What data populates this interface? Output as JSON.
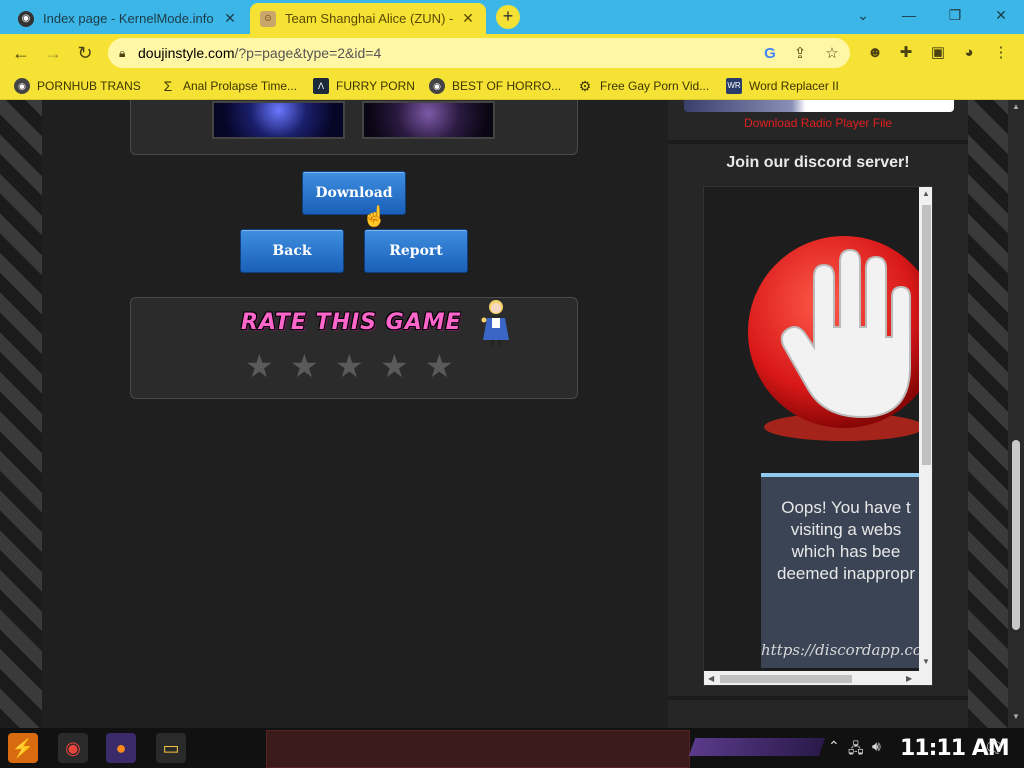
{
  "tabs": [
    {
      "title": "Index page - KernelMode.info",
      "favicon": "globe-icon",
      "active": false
    },
    {
      "title": "Team Shanghai Alice (ZUN) - ",
      "favicon": "doujinstyle-icon",
      "active": true
    }
  ],
  "toolbar": {
    "url_host": "doujinstyle.com",
    "url_path": "/?p=page&type=2&id=4"
  },
  "bookmarks": [
    {
      "label": "PORNHUB TRANS",
      "icon": "globe-icon"
    },
    {
      "label": "Anal Prolapse Time...",
      "icon": "sigma-icon"
    },
    {
      "label": "FURRY PORN",
      "icon": "arrow-logo-icon"
    },
    {
      "label": "BEST OF HORRO...",
      "icon": "globe-icon"
    },
    {
      "label": "Free Gay Porn Vid...",
      "icon": "gear-icon"
    },
    {
      "label": "Word Replacer II",
      "icon": "wr-icon"
    }
  ],
  "main": {
    "download_label": "Download",
    "back_label": "Back",
    "report_label": "Report",
    "rate_title": "RATE THIS GAME",
    "stars_total": 5,
    "rating": 0
  },
  "sidebar": {
    "radio_link": "Download Radio Player File",
    "discord_heading": "Join our discord server!",
    "blocked_lines": [
      "Oops! You have t",
      "visiting a webs",
      "which has bee",
      "deemed inappropr"
    ],
    "blocked_url": "https://discordapp.co"
  },
  "taskbar": {
    "clock": "11:11 AM"
  },
  "colors": {
    "tabbar": "#3bb6e6",
    "chrome_yellow": "#f5e234",
    "button_blue": "#1a5fb8",
    "rate_pink": "#ff66cc",
    "link_red": "#e02020",
    "stop_red": "#d81818"
  }
}
